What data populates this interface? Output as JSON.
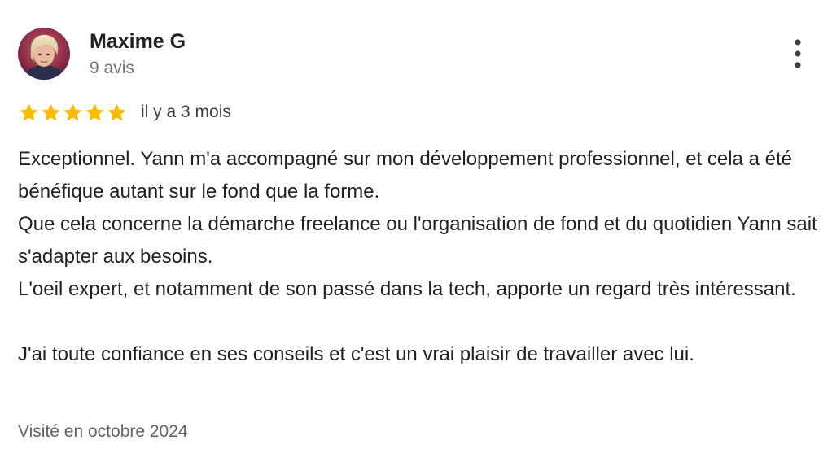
{
  "review": {
    "author": {
      "name": "Maxime G",
      "review_count": "9 avis",
      "avatar_icon": "profile-photo"
    },
    "rating": {
      "stars": 5,
      "max_stars": 5,
      "star_color": "#fbbc04"
    },
    "date": "il y a 3 mois",
    "paragraphs": [
      "Exceptionnel. Yann m'a accompagné sur mon développement professionnel, et cela a été bénéfique autant sur le fond que la forme.",
      "Que cela concerne la démarche freelance ou l'organisation de fond et du quotidien Yann sait s'adapter aux besoins.",
      "L'oeil expert, et notamment de son passé dans la tech, apporte un regard très intéressant.",
      "",
      "J'ai toute confiance en ses conseils et c'est un vrai plaisir de travailler avec lui."
    ],
    "visit": "Visité en octobre 2024",
    "menu_icon": "more-vert-icon"
  }
}
